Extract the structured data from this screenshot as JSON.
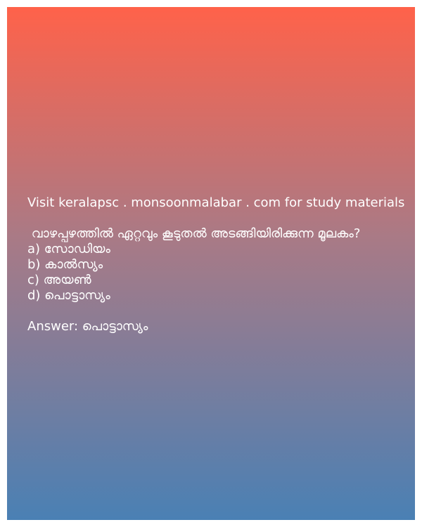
{
  "visit_line": "Visit keralapsc . monsoonmalabar . com for study materials",
  "question": " വാഴപ്പഴത്തിൽ ഏറ്റവും കൂടുതൽ അടങ്ങിയിരിക്കുന്ന മൂലകം?",
  "options": [
    "a) സോഡിയം",
    "b) കാൽസ്യം",
    "c) അയൺ",
    "d) പൊട്ടാസ്യം"
  ],
  "answer": "Answer: പൊട്ടാസ്യം",
  "colors": {
    "gradient_top": "#ff624a",
    "gradient_bottom": "#4a80b4",
    "text": "#ffffff"
  }
}
